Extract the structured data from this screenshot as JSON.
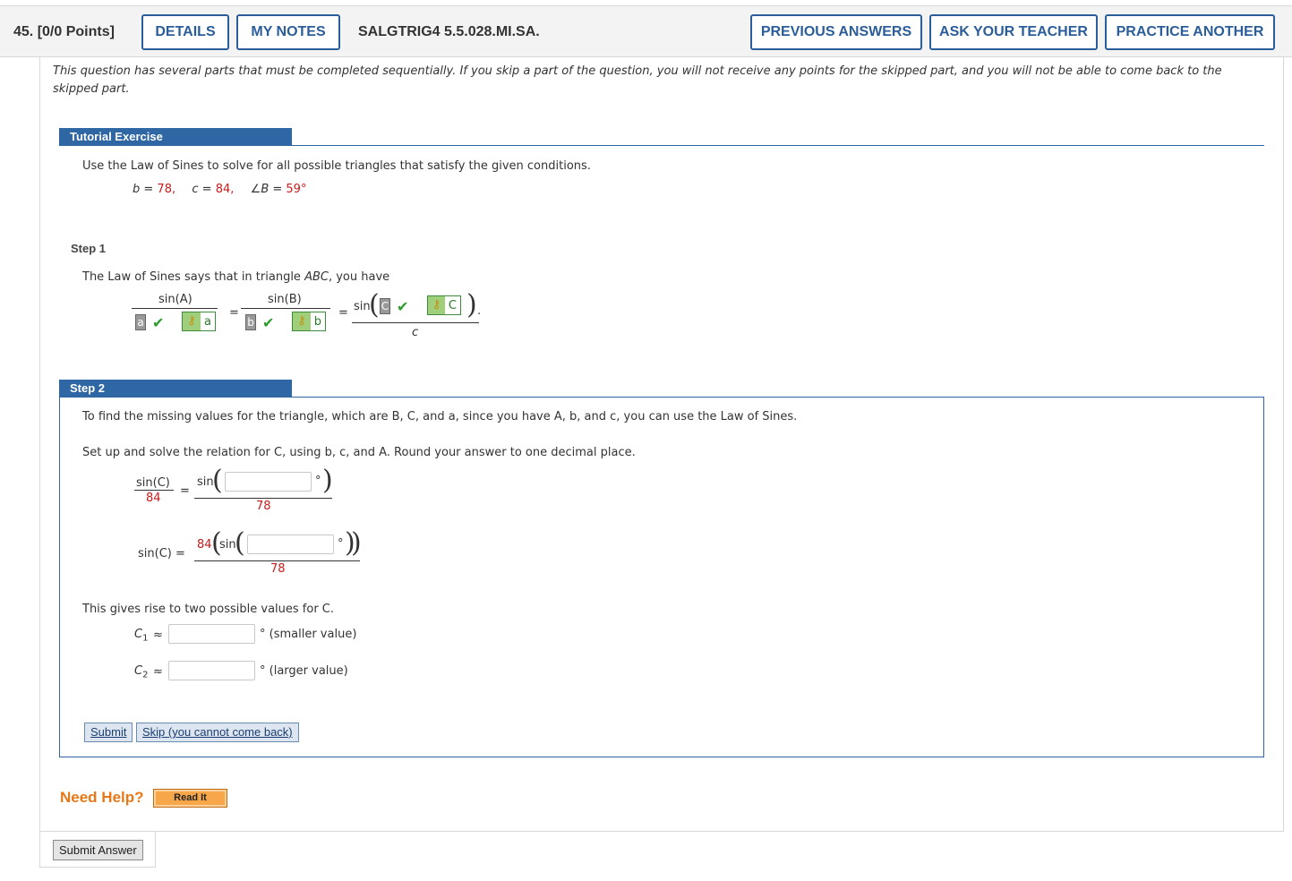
{
  "header": {
    "question_number": "45. [0/0 Points]",
    "details_label": "DETAILS",
    "my_notes_label": "MY NOTES",
    "question_code": "SALGTRIG4 5.5.028.MI.SA.",
    "previous_answers_label": "PREVIOUS ANSWERS",
    "ask_teacher_label": "ASK YOUR TEACHER",
    "practice_another_label": "PRACTICE ANOTHER"
  },
  "intro_text": "This question has several parts that must be completed sequentially. If you skip a part of the question, you will not receive any points for the skipped part, and you will not be able to come back to the skipped part.",
  "tutorial": {
    "header": "Tutorial Exercise",
    "prompt": "Use the Law of Sines to solve for all possible triangles that satisfy the given conditions.",
    "conditions": {
      "b_label": "b = ",
      "b_value": "78,",
      "c_label": "c = ",
      "c_value": "84,",
      "B_label": "∠B = ",
      "B_value": "59°"
    }
  },
  "step1": {
    "label": "Step 1",
    "text_prefix": "The Law of Sines says that in triangle ",
    "text_triangle": "ABC",
    "text_suffix": ", you have",
    "sinA": "sin(A)",
    "sinB": "sin(B)",
    "sin_prefix": "sin",
    "eq": "=",
    "a_entered": "a",
    "a_key": "a",
    "b_entered": "b",
    "b_key": "b",
    "c_entered": "C",
    "c_key": "C",
    "c_denominator": "c",
    "period": "."
  },
  "step2": {
    "label": "Step 2",
    "text1": "To find the missing values for the triangle, which are B, C, and a, since you have A, b, and c, you can use the Law of Sines.",
    "text2": "Set up and solve the relation for C, using b, c, and A. Round your answer to one decimal place.",
    "sinC_num": "sin(C)",
    "sinC_den": "84",
    "sin_label": "sin",
    "den78": "78",
    "sinC_label": "sin(C) =",
    "coef84": "84",
    "degree": "°",
    "two_values_text": "This gives rise to two possible values for C.",
    "C1_label": "C",
    "C1_sub": "1",
    "approx": "≈",
    "C1_note": "° (smaller value)",
    "C2_label": "C",
    "C2_sub": "2",
    "C2_note": "° (larger value)",
    "submit_label": "Submit",
    "skip_label": "Skip (you cannot come back)"
  },
  "help": {
    "need_help": "Need Help?",
    "read_it": "Read It"
  },
  "submit_answer_label": "Submit Answer",
  "colors": {
    "accent_blue": "#2e67a4",
    "value_red": "#cc1a1a",
    "help_orange": "#e87817",
    "check_green": "#2a9d2a"
  }
}
